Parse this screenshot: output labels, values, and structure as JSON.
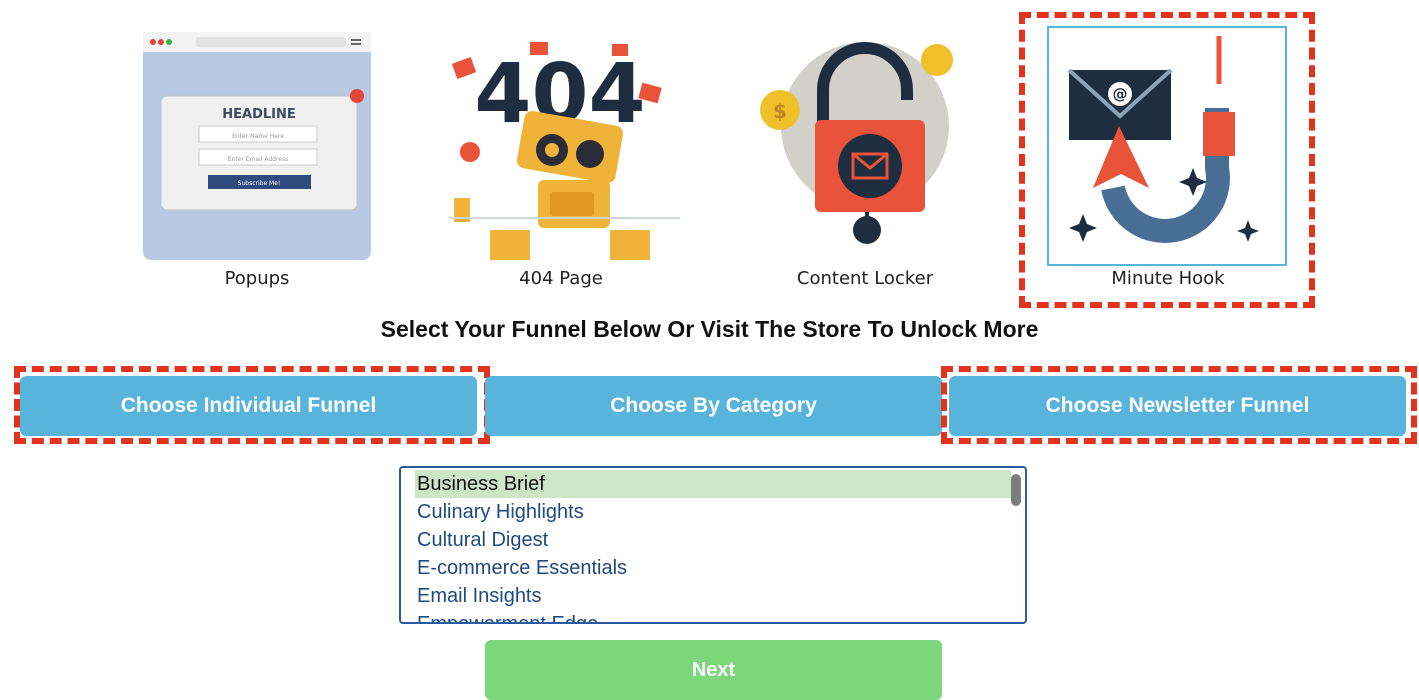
{
  "tiles": [
    {
      "label": "Popups",
      "icon": "popup-window-icon"
    },
    {
      "label": "404 Page",
      "icon": "robot-404-icon"
    },
    {
      "label": "Content Locker",
      "icon": "padlock-icon"
    },
    {
      "label": "Minute Hook",
      "icon": "email-hook-icon"
    }
  ],
  "popup_preview": {
    "headline": "HEADLINE",
    "name_placeholder": "Enter Name Here",
    "email_placeholder": "Enter Email Address",
    "subscribe_label": "Subscribe Me!"
  },
  "robot_preview": {
    "code": "404"
  },
  "locker_preview": {
    "currency": "$"
  },
  "hook_preview": {
    "symbol": "@"
  },
  "heading": "Select Your Funnel Below Or Visit The Store To Unlock More",
  "funnel_buttons": {
    "individual": "Choose Individual Funnel",
    "category": "Choose By Category",
    "newsletter": "Choose Newsletter Funnel"
  },
  "newsletter_list": {
    "items": [
      "Business Brief",
      "Culinary Highlights",
      "Cultural Digest",
      "E-commerce Essentials",
      "Email Insights",
      "Empowerment Edge"
    ],
    "selected": "Business Brief"
  },
  "next_label": "Next",
  "colors": {
    "highlight_dash": "#e2331f",
    "funnel_button": "#59b4dc",
    "next_button": "#7cd67a",
    "selected_row": "#cde6c8"
  }
}
